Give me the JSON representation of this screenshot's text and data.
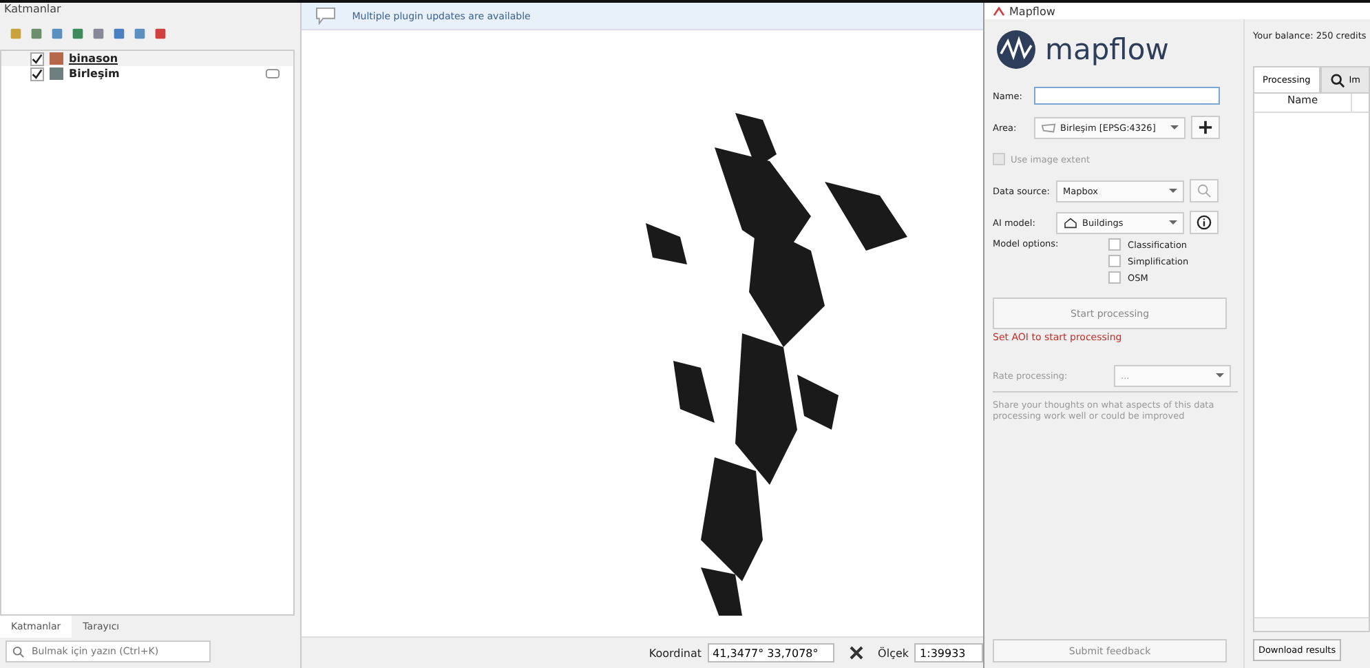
{
  "layers_panel": {
    "title": "Katmanlar",
    "layers": [
      {
        "name": "binason",
        "checked": true,
        "color": "#b5694a",
        "selected": true
      },
      {
        "name": "Birleşim",
        "checked": true,
        "color": "#6f7f7f",
        "selected": false
      }
    ],
    "tabs": [
      {
        "label": "Katmanlar",
        "selected": true
      },
      {
        "label": "Tarayıcı",
        "selected": false
      }
    ],
    "search": {
      "placeholder": "Bulmak için yazın (Ctrl+K)"
    }
  },
  "message_bar": {
    "text": "Multiple plugin updates are available"
  },
  "status_bar": {
    "coordinate_label": "Koordinat",
    "coordinate": "41,3477° 33,7078°",
    "scale_label": "Ölçek",
    "scale": "1:39933"
  },
  "mapflow": {
    "title": "Mapflow",
    "logo": "mapflow",
    "balance": "Your balance: 250 credits",
    "name_label": "Name:",
    "area_label": "Area:",
    "area": "Birleşim [EPSG:4326]",
    "use_image_extent": {
      "label": "Use image extent",
      "checked": false,
      "disabled": true
    },
    "data_source_label": "Data source:",
    "data_source": "Mapbox",
    "ai_model_label": "AI model:",
    "ai_model": "Buildings",
    "model_options_label": "Model options:",
    "options": [
      {
        "label": "Classification",
        "checked": false
      },
      {
        "label": "Simplification",
        "checked": false
      },
      {
        "label": "OSM",
        "checked": false
      }
    ],
    "start_button": "Start processing",
    "warning": "Set AOI to start processing",
    "rate_label": "Rate processing:",
    "rate_value": "...",
    "feedback_placeholder": "Share your thoughts on what aspects of this data processing work well or could be improved",
    "submit_button": "Submit feedback",
    "tabs": [
      {
        "label": "Processing",
        "selected": true
      },
      {
        "label": "Im",
        "selected": false
      }
    ],
    "table": {
      "columns": [
        "Name"
      ]
    },
    "download_button": "Download results"
  }
}
